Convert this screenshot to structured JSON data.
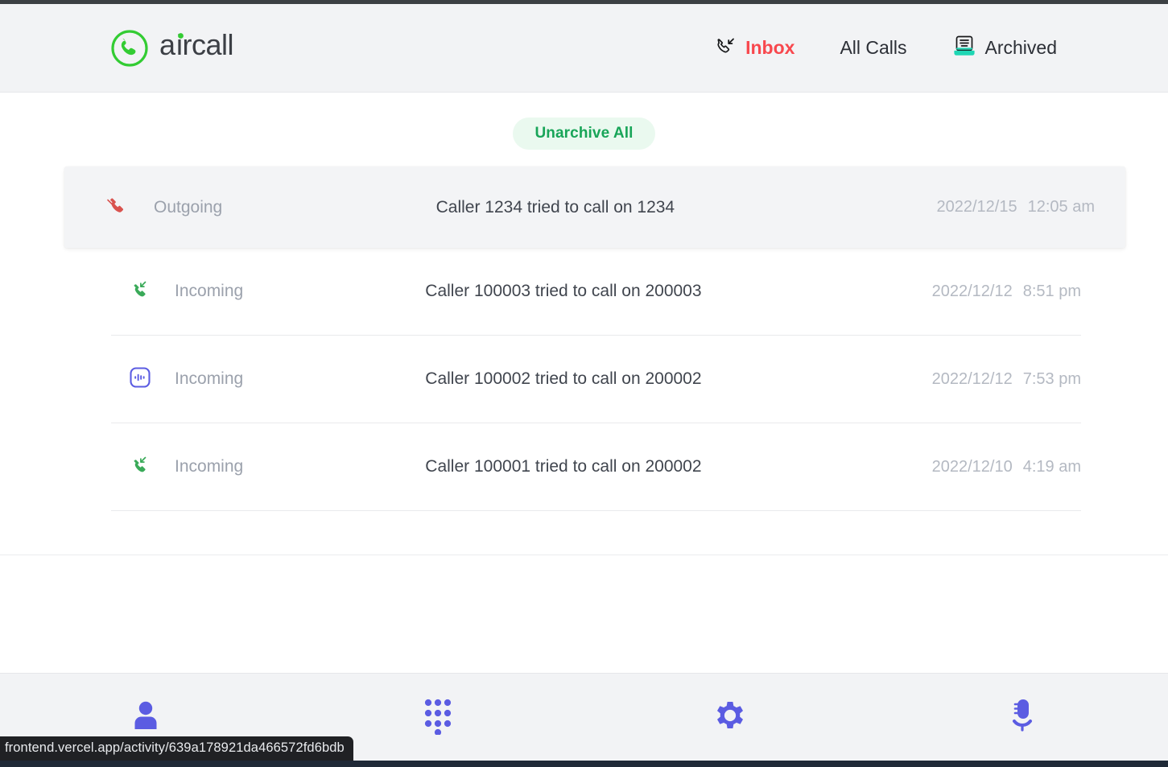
{
  "brand": {
    "name": "aircall",
    "logo_icon": "aircall-phone-logo",
    "logo_color": "#33cc33",
    "wordmark_color": "#3c3f45"
  },
  "header": {
    "nav": [
      {
        "id": "inbox",
        "label": "Inbox",
        "icon": "phone-incoming-icon",
        "active": true,
        "accent": "#f8484e"
      },
      {
        "id": "all-calls",
        "label": "All Calls",
        "icon": "none",
        "active": false,
        "accent": "#2c2f36"
      },
      {
        "id": "archived",
        "label": "Archived",
        "icon": "archive-tray-icon",
        "active": false,
        "accent": "#2c2f36"
      }
    ]
  },
  "main": {
    "unarchive_all_label": "Unarchive All",
    "unarchive_all_color": "#18a558",
    "unarchive_all_bg": "#eaf9ef",
    "calls": [
      {
        "direction": "Outgoing",
        "icon": "phone-missed-outgoing-icon",
        "icon_color": "#d9534f",
        "description": "Caller 1234 tried to call on 1234",
        "date": "2022/12/15",
        "time": "12:05 am",
        "highlighted": true
      },
      {
        "direction": "Incoming",
        "icon": "phone-incoming-green-icon",
        "icon_color": "#3aaa59",
        "description": "Caller 100003 tried to call on 200003",
        "date": "2022/12/12",
        "time": "8:51 pm",
        "highlighted": false
      },
      {
        "direction": "Incoming",
        "icon": "voicemail-icon",
        "icon_color": "#5b5ce2",
        "description": "Caller 100002 tried to call on 200002",
        "date": "2022/12/12",
        "time": "7:53 pm",
        "highlighted": false
      },
      {
        "direction": "Incoming",
        "icon": "phone-incoming-green-icon",
        "icon_color": "#3aaa59",
        "description": "Caller 100001 tried to call on 200002",
        "date": "2022/12/10",
        "time": "4:19 am",
        "highlighted": false
      }
    ]
  },
  "bottom_bar": {
    "accent_color": "#5b5ce2",
    "items": [
      {
        "id": "contacts",
        "icon": "person-icon"
      },
      {
        "id": "dialpad",
        "icon": "dialpad-icon"
      },
      {
        "id": "settings",
        "icon": "gear-icon"
      },
      {
        "id": "voicemail",
        "icon": "microphone-icon"
      }
    ]
  },
  "status_bar": {
    "url": "frontend.vercel.app/activity/639a178921da466572fd6bdb"
  }
}
